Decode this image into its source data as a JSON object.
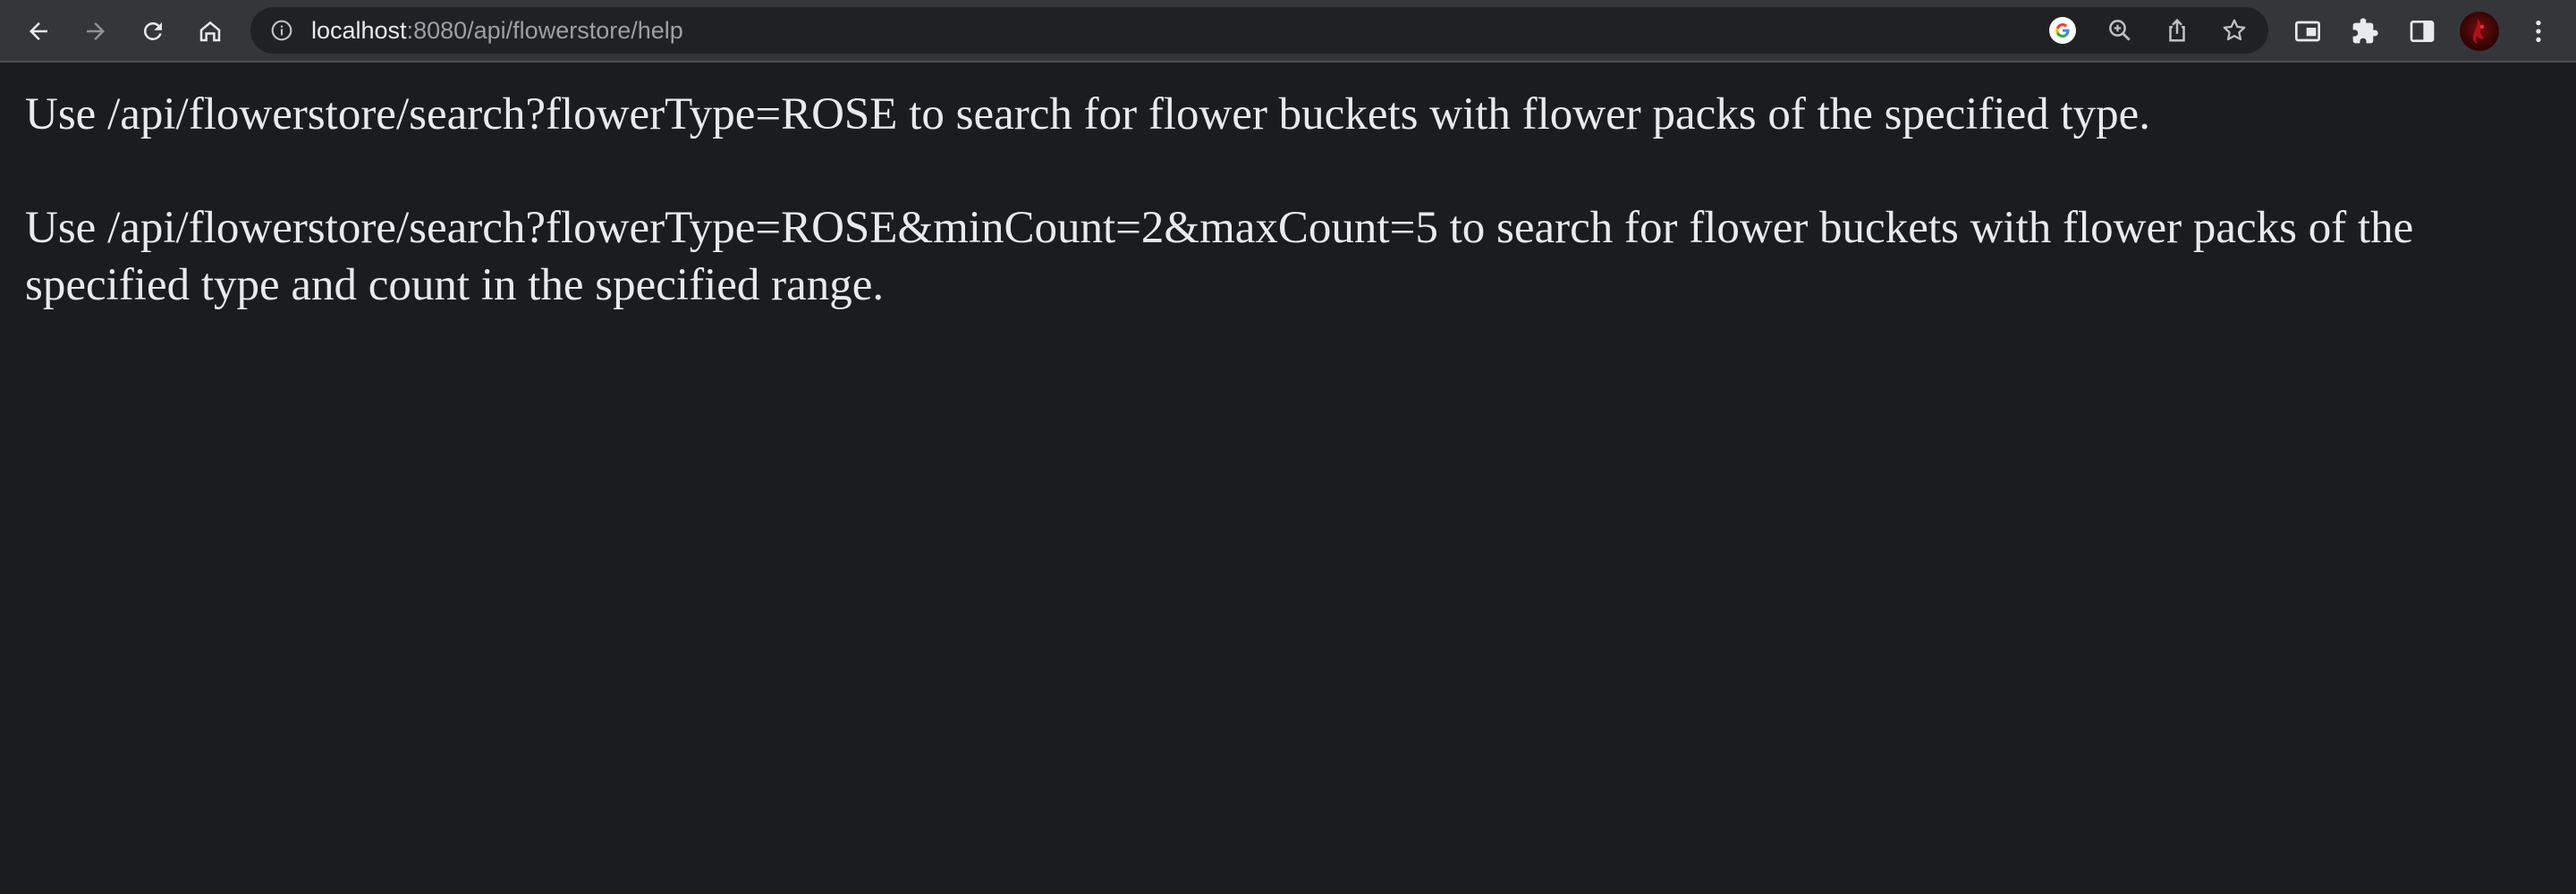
{
  "browser": {
    "url_host": "localhost",
    "url_path": ":8080/api/flowerstore/help"
  },
  "page": {
    "paragraphs": [
      "Use /api/flowerstore/search?flowerType=ROSE to search for flower buckets with flower packs of the specified type.",
      "Use /api/flowerstore/search?flowerType=ROSE&minCount=2&maxCount=5 to search for flower buckets with flower packs of the specified type and count in the specified range."
    ]
  },
  "icons": {
    "back": "back-arrow-icon",
    "forward": "forward-arrow-icon",
    "reload": "reload-icon",
    "home": "home-icon",
    "site_info": "info-icon",
    "google": "google-icon",
    "zoom": "zoom-icon",
    "share": "share-icon",
    "bookmark": "star-icon",
    "cast": "picture-in-picture-icon",
    "extensions": "puzzle-icon",
    "side_panel": "side-panel-icon",
    "profile": "avatar",
    "menu": "kebab-menu-icon"
  },
  "colors": {
    "toolbar_bg": "#35363a",
    "omnibox_bg": "#202124",
    "page_bg": "#1b1c1e",
    "text": "#e8eaed",
    "url_muted": "#9aa0a6"
  }
}
